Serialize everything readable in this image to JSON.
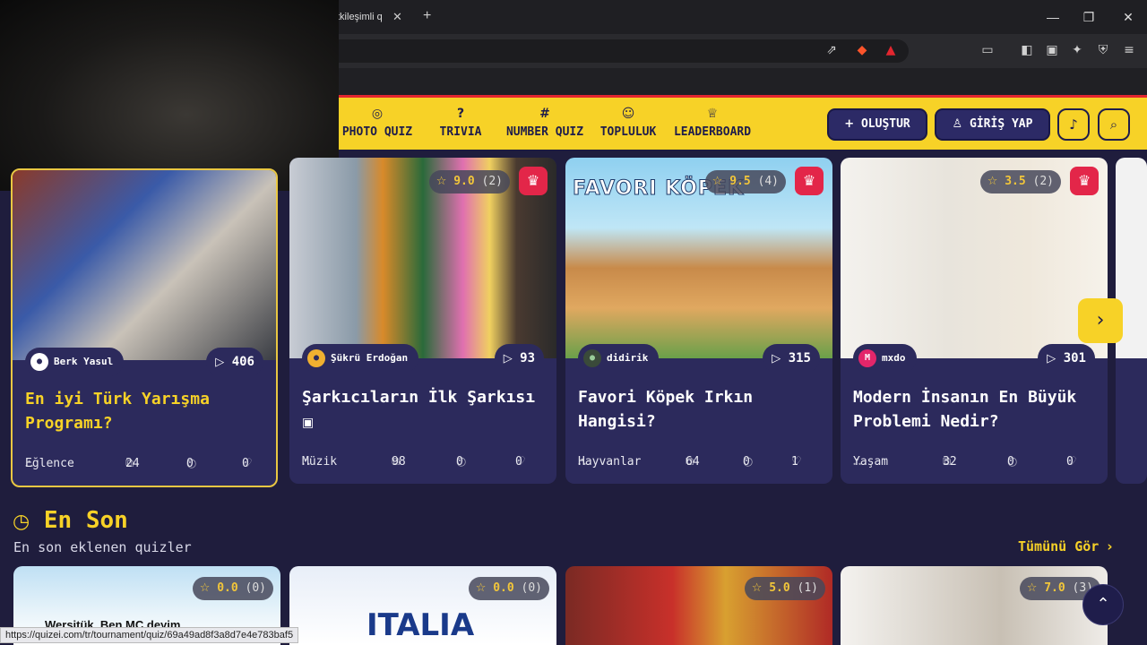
{
  "browser": {
    "tab_title": "tkileşimli q",
    "status_url": "https://quizei.com/tr/tournament/quiz/69a49ad8f3a8d7e4e783baf5"
  },
  "navbar": {
    "items": [
      {
        "label": "PHOTO QUIZ",
        "icon": "camera-icon"
      },
      {
        "label": "TRIVIA",
        "icon": "question-icon"
      },
      {
        "label": "NUMBER QUIZ",
        "icon": "hash-icon"
      },
      {
        "label": "TOPLULUK",
        "icon": "users-icon"
      },
      {
        "label": "LEADERBOARD",
        "icon": "trophy-icon"
      }
    ],
    "create_label": "OLUŞTUR",
    "login_label": "GİRİŞ YAP"
  },
  "featured": [
    {
      "title": "En iyi Türk Yarışma Programı?",
      "author": "Berk Yasul",
      "plays": "406",
      "category": "Eğlence",
      "questions": "24",
      "comments": "0",
      "likes": "0"
    },
    {
      "title": "Şarkıcıların İlk Şarkısı",
      "author": "Şükrü Erdoğan",
      "plays": "93",
      "category": "Müzik",
      "questions": "98",
      "comments": "0",
      "likes": "0",
      "rating": "9.0",
      "rating_count": "(2)"
    },
    {
      "title": "Favori Köpek Irkın Hangisi?",
      "author": "didirik",
      "plays": "315",
      "category": "Hayvanlar",
      "questions": "64",
      "comments": "0",
      "likes": "1",
      "rating": "9.5",
      "rating_count": "(4)",
      "image_text": "FAVORI KÖPEK"
    },
    {
      "title": "Modern İnsanın En Büyük Problemi Nedir?",
      "author": "mxdo",
      "plays": "301",
      "category": "Yaşam",
      "questions": "32",
      "comments": "0",
      "likes": "0",
      "rating": "3.5",
      "rating_count": "(2)",
      "author_initial": "M"
    }
  ],
  "latest": {
    "title": "En Son",
    "subtitle": "En son eklenen quizler",
    "see_all": "Tümünü Gör",
    "cards": [
      {
        "rating": "0.0",
        "rating_count": "(0)"
      },
      {
        "rating": "0.0",
        "rating_count": "(0)",
        "image_text": "ITALIA"
      },
      {
        "rating": "5.0",
        "rating_count": "(1)"
      },
      {
        "rating": "7.0",
        "rating_count": "(3)"
      }
    ]
  },
  "overlay_text": "Wersitük. Ben MC deyim",
  "colors": {
    "accent": "#f7d227",
    "navy": "#2c2a5c",
    "crown": "#e32649"
  }
}
